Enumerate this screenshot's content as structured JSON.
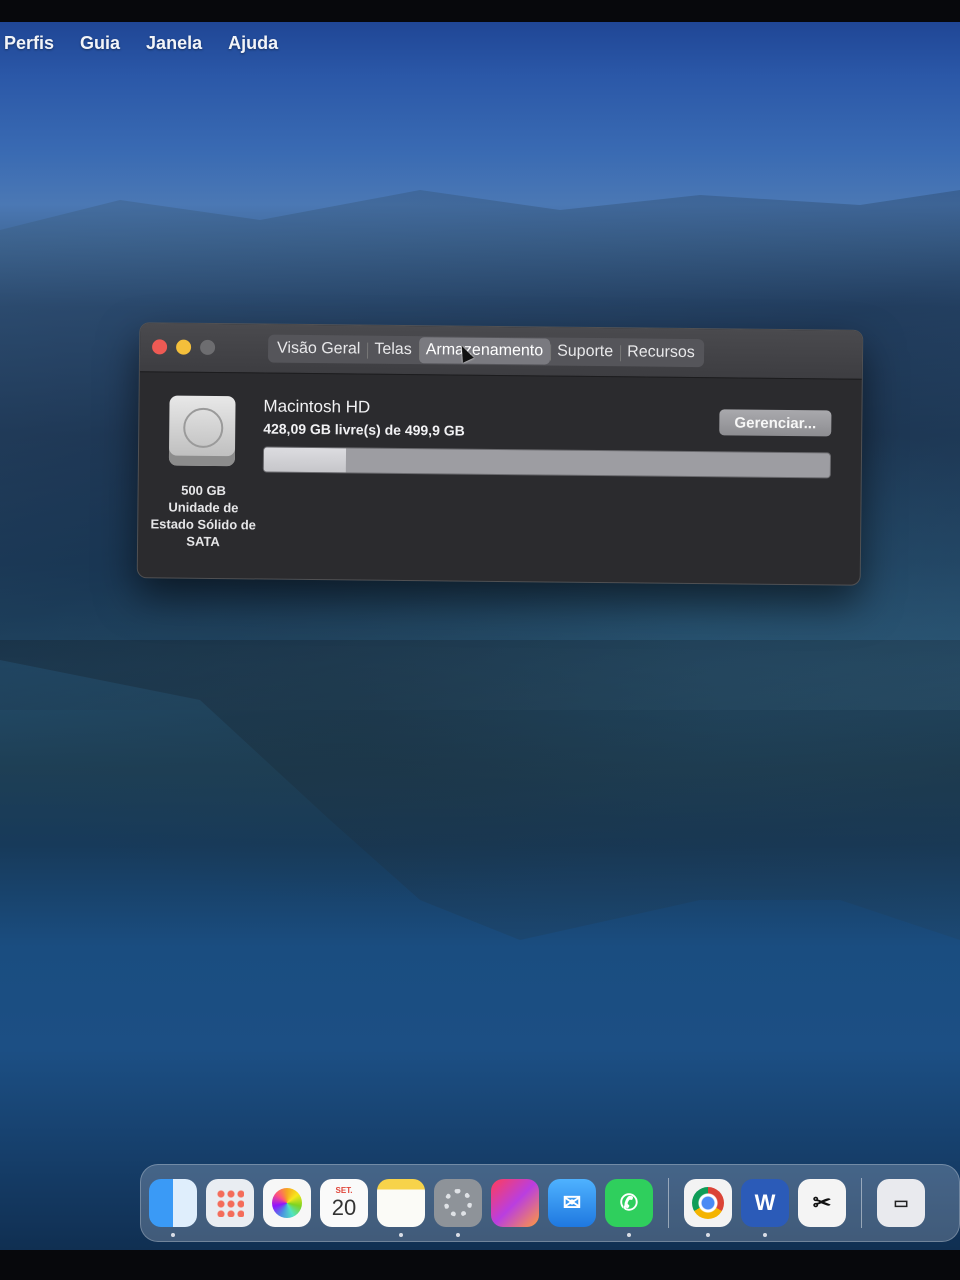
{
  "menubar": {
    "items": [
      "Perfis",
      "Guia",
      "Janela",
      "Ajuda"
    ]
  },
  "window": {
    "tabs": [
      {
        "label": "Visão Geral",
        "active": false
      },
      {
        "label": "Telas",
        "active": false
      },
      {
        "label": "Armazenamento",
        "active": true
      },
      {
        "label": "Suporte",
        "active": false
      },
      {
        "label": "Recursos",
        "active": false
      }
    ],
    "disk": {
      "capacity": "500 GB",
      "type_line1": "Unidade de",
      "type_line2": "Estado Sólido de",
      "type_line3": "SATA"
    },
    "volume": {
      "name": "Macintosh HD",
      "free_text": "428,09 GB livre(s) de 499,9 GB",
      "used_fraction": 0.144
    },
    "manage_button": "Gerenciar..."
  },
  "dock": {
    "items": [
      {
        "icon": "finder-icon",
        "running": true
      },
      {
        "icon": "launchpad-icon",
        "running": false
      },
      {
        "icon": "photos-icon",
        "running": false
      },
      {
        "icon": "calendar-icon",
        "month": "SET.",
        "day": "20",
        "running": false
      },
      {
        "icon": "notes-icon",
        "running": true
      },
      {
        "icon": "system-preferences-icon",
        "running": true
      },
      {
        "icon": "creative-cloud-icon",
        "running": false
      },
      {
        "icon": "mail-icon",
        "running": false
      },
      {
        "icon": "whatsapp-icon",
        "running": true
      },
      {
        "icon": "chrome-icon",
        "running": true
      },
      {
        "icon": "word-icon",
        "glyph": "W",
        "running": true
      },
      {
        "icon": "capcut-icon",
        "running": false
      },
      {
        "icon": "screen-icon",
        "running": false
      }
    ]
  },
  "colors": {
    "close": "#ee5a54",
    "minimize": "#f4bf3b",
    "zoom": "#6d6d70",
    "window_bg": "#2b2b2e"
  }
}
